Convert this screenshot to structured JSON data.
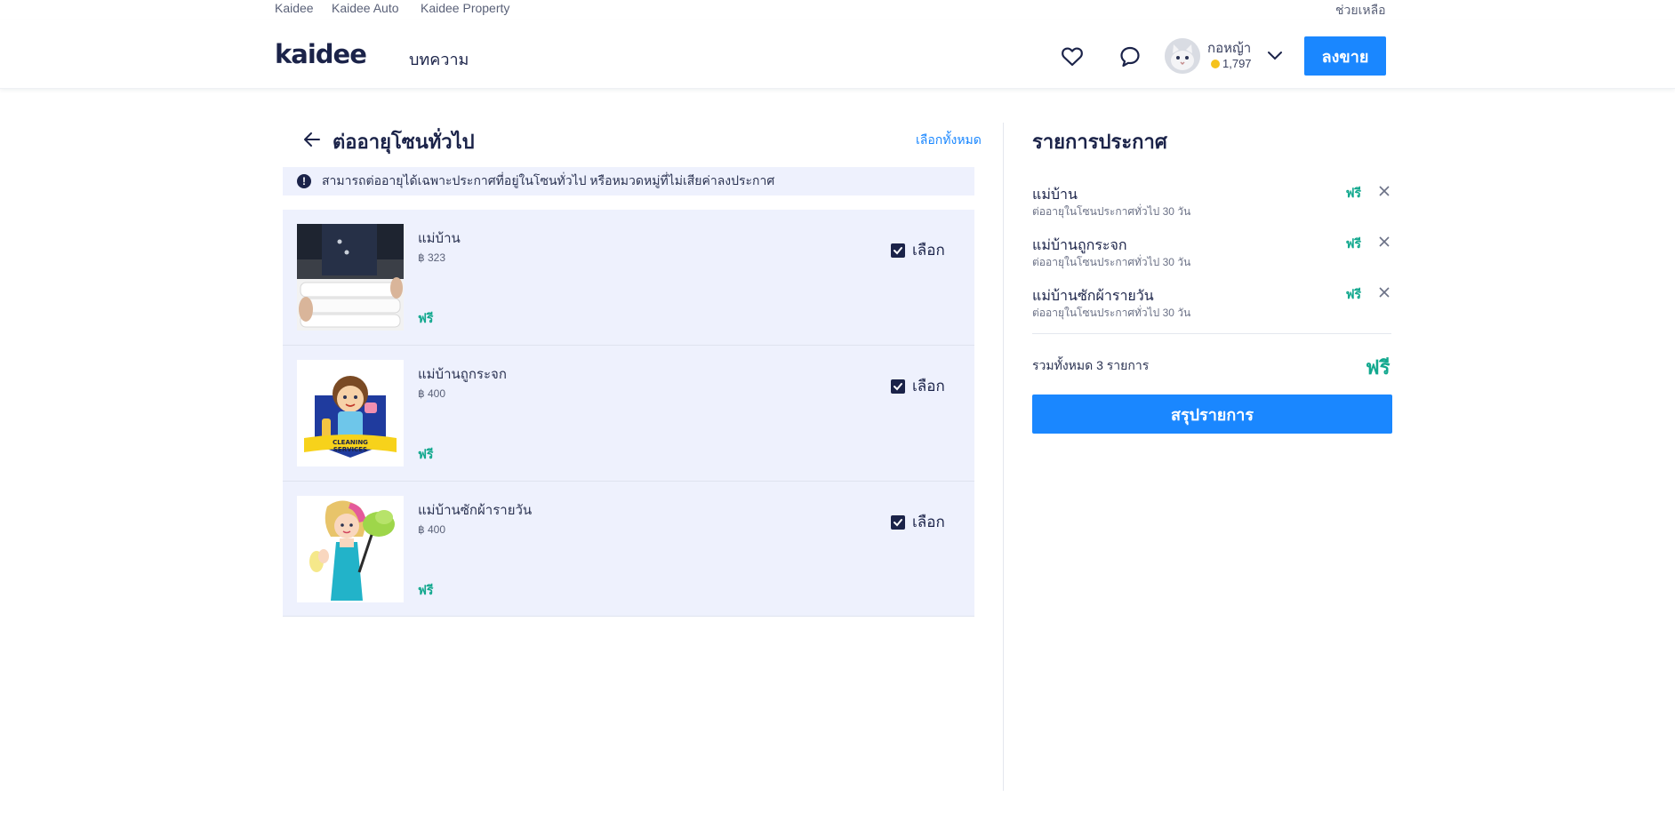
{
  "topbar": {
    "links": [
      "Kaidee",
      "Kaidee Auto",
      "Kaidee Property"
    ],
    "help": "ช่วยเหลือ"
  },
  "header": {
    "logo": "kaidee",
    "nav_article": "บทความ",
    "username": "กอหญ้า",
    "coins": "1,797",
    "post_button": "ลงขาย"
  },
  "page": {
    "title": "ต่ออายุโซนทั่วไป",
    "select_all": "เลือกทั้งหมด",
    "notice": "สามารถต่ออายุได้เฉพาะประกาศที่อยู่ในโซนทั่วไป หรือหมวดหมู่ที่ไม่เสียค่าลงประกาศ"
  },
  "items": [
    {
      "title": "แม่บ้าน",
      "price": "฿ 323",
      "free": "ฟรี",
      "select_label": "เลือก",
      "checked": true,
      "image": "housekeeper-towels-photo"
    },
    {
      "title": "แม่บ้านถูกระจก",
      "price": "฿ 400",
      "free": "ฟรี",
      "select_label": "เลือก",
      "checked": true,
      "image": "cleaning-services-cartoon",
      "image_text": "CLEANING SERVICES"
    },
    {
      "title": "แม่บ้านซักผ้ารายวัน",
      "price": "฿ 400",
      "free": "ฟรี",
      "select_label": "เลือก",
      "checked": true,
      "image": "maid-duster-cartoon"
    }
  ],
  "summary": {
    "title": "รายการประกาศ",
    "items": [
      {
        "name": "แม่บ้าน",
        "desc": "ต่ออายุในโซนประกาศทั่วไป 30 วัน",
        "price": "ฟรี"
      },
      {
        "name": "แม่บ้านถูกระจก",
        "desc": "ต่ออายุในโซนประกาศทั่วไป 30 วัน",
        "price": "ฟรี"
      },
      {
        "name": "แม่บ้านซักผ้ารายวัน",
        "desc": "ต่ออายุในโซนประกาศทั่วไป 30 วัน",
        "price": "ฟรี"
      }
    ],
    "total_label": "รวมทั้งหมด 3 รายการ",
    "total_value": "ฟรี",
    "button": "สรุปรายการ"
  },
  "colors": {
    "primary": "#1a87ff",
    "navy": "#1b2349",
    "free_green": "#12a88e",
    "row_bg": "#eef1fd"
  }
}
